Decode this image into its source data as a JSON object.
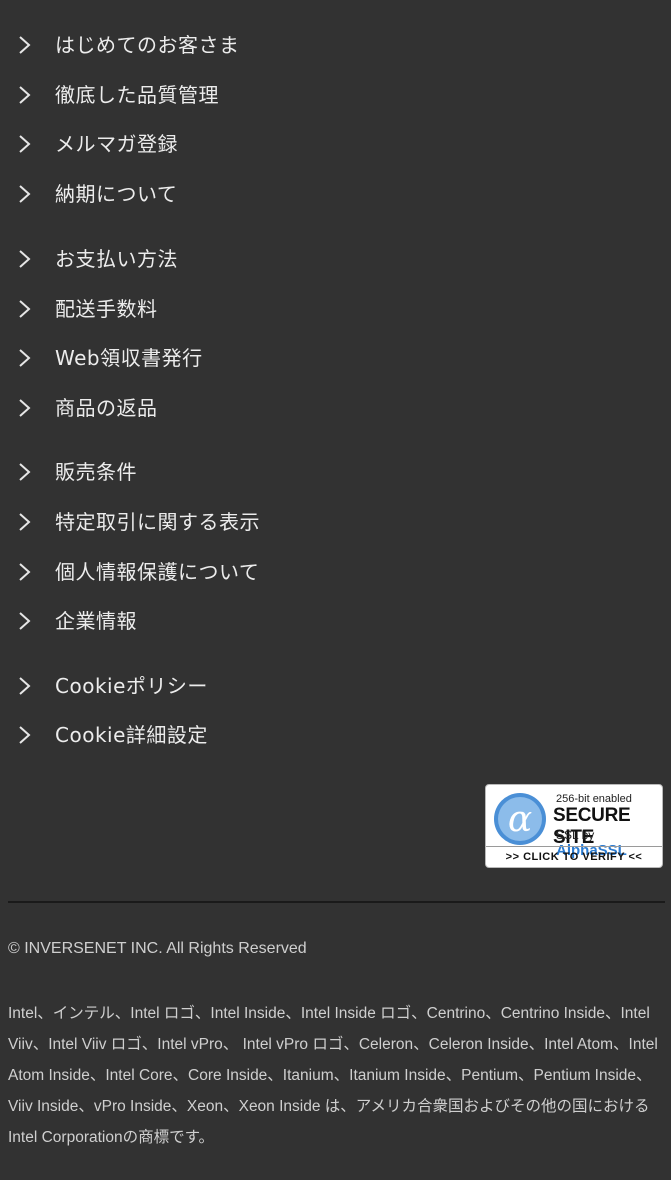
{
  "menu": {
    "items": [
      {
        "label": "はじめてのお客さま"
      },
      {
        "label": "徹底した品質管理"
      },
      {
        "label": "メルマガ登録"
      },
      {
        "label": "納期について"
      },
      {
        "label": "お支払い方法"
      },
      {
        "label": "配送手数料"
      },
      {
        "label": "Web領収書発行"
      },
      {
        "label": "商品の返品"
      },
      {
        "label": "販売条件"
      },
      {
        "label": "特定取引に関する表示"
      },
      {
        "label": "個人情報保護について"
      },
      {
        "label": "企業情報"
      },
      {
        "label": "Cookieポリシー"
      },
      {
        "label": "Cookie詳細設定"
      }
    ],
    "chevron_icon": "chevron-right-icon"
  },
  "ssl_badge": {
    "line1": "256-bit enabled",
    "line2": "SECURE SITE",
    "line3_prefix": "SSL by ",
    "line3_brand": "AlphaSSL",
    "verify": ">> CLICK TO VERIFY <<",
    "brand_color": "#2a7bd1"
  },
  "footer": {
    "copyright": "© INVERSENET INC. All Rights Reserved",
    "trademark": "Intel、インテル、Intel ロゴ、Intel Inside、Intel Inside ロゴ、Centrino、Centrino Inside、Intel Viiv、Intel Viiv ロゴ、Intel vPro、 Intel vPro ロゴ、Celeron、Celeron Inside、Intel Atom、Intel Atom Inside、Intel Core、Core Inside、Itanium、Itanium Inside、Pentium、Pentium Inside、Viiv Inside、vPro Inside、Xeon、Xeon Inside は、アメリカ合衆国およびその他の国における Intel Corporationの商標です。"
  },
  "colors": {
    "background": "#323232",
    "text": "#ececec",
    "divider": "#1a1a1a"
  }
}
